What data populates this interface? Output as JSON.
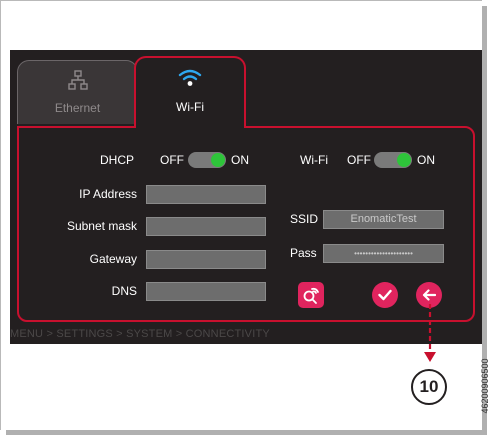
{
  "tabs": [
    {
      "label": "Ethernet",
      "icon": "network-icon",
      "active": false
    },
    {
      "label": "Wi-Fi",
      "icon": "wifi-icon",
      "active": true
    }
  ],
  "ethernet": {
    "dhcp_label": "DHCP",
    "dhcp_off": "OFF",
    "dhcp_on": "ON",
    "dhcp_state": "on",
    "fields": [
      {
        "label": "IP Address",
        "value": ""
      },
      {
        "label": "Subnet mask",
        "value": ""
      },
      {
        "label": "Gateway",
        "value": ""
      },
      {
        "label": "DNS",
        "value": ""
      }
    ]
  },
  "wifi": {
    "toggle_label": "Wi-Fi",
    "toggle_off": "OFF",
    "toggle_on": "ON",
    "toggle_state": "on",
    "ssid_label": "SSID",
    "ssid_value": "EnomaticTest",
    "pass_label": "Pass",
    "pass_value": "•••••••••••••••••••••"
  },
  "buttons": {
    "search": "wifi-search-icon",
    "confirm": "check-icon",
    "back": "arrow-left-icon"
  },
  "breadcrumb": "MENU > SETTINGS > SYSTEM > CONNECTIVITY",
  "callout": {
    "number": "10"
  },
  "doc_code": "46200906500",
  "colors": {
    "accent": "#e0245e",
    "border": "#c8102e",
    "screen_bg": "#231f20",
    "toggle_on": "#2ec43a"
  }
}
